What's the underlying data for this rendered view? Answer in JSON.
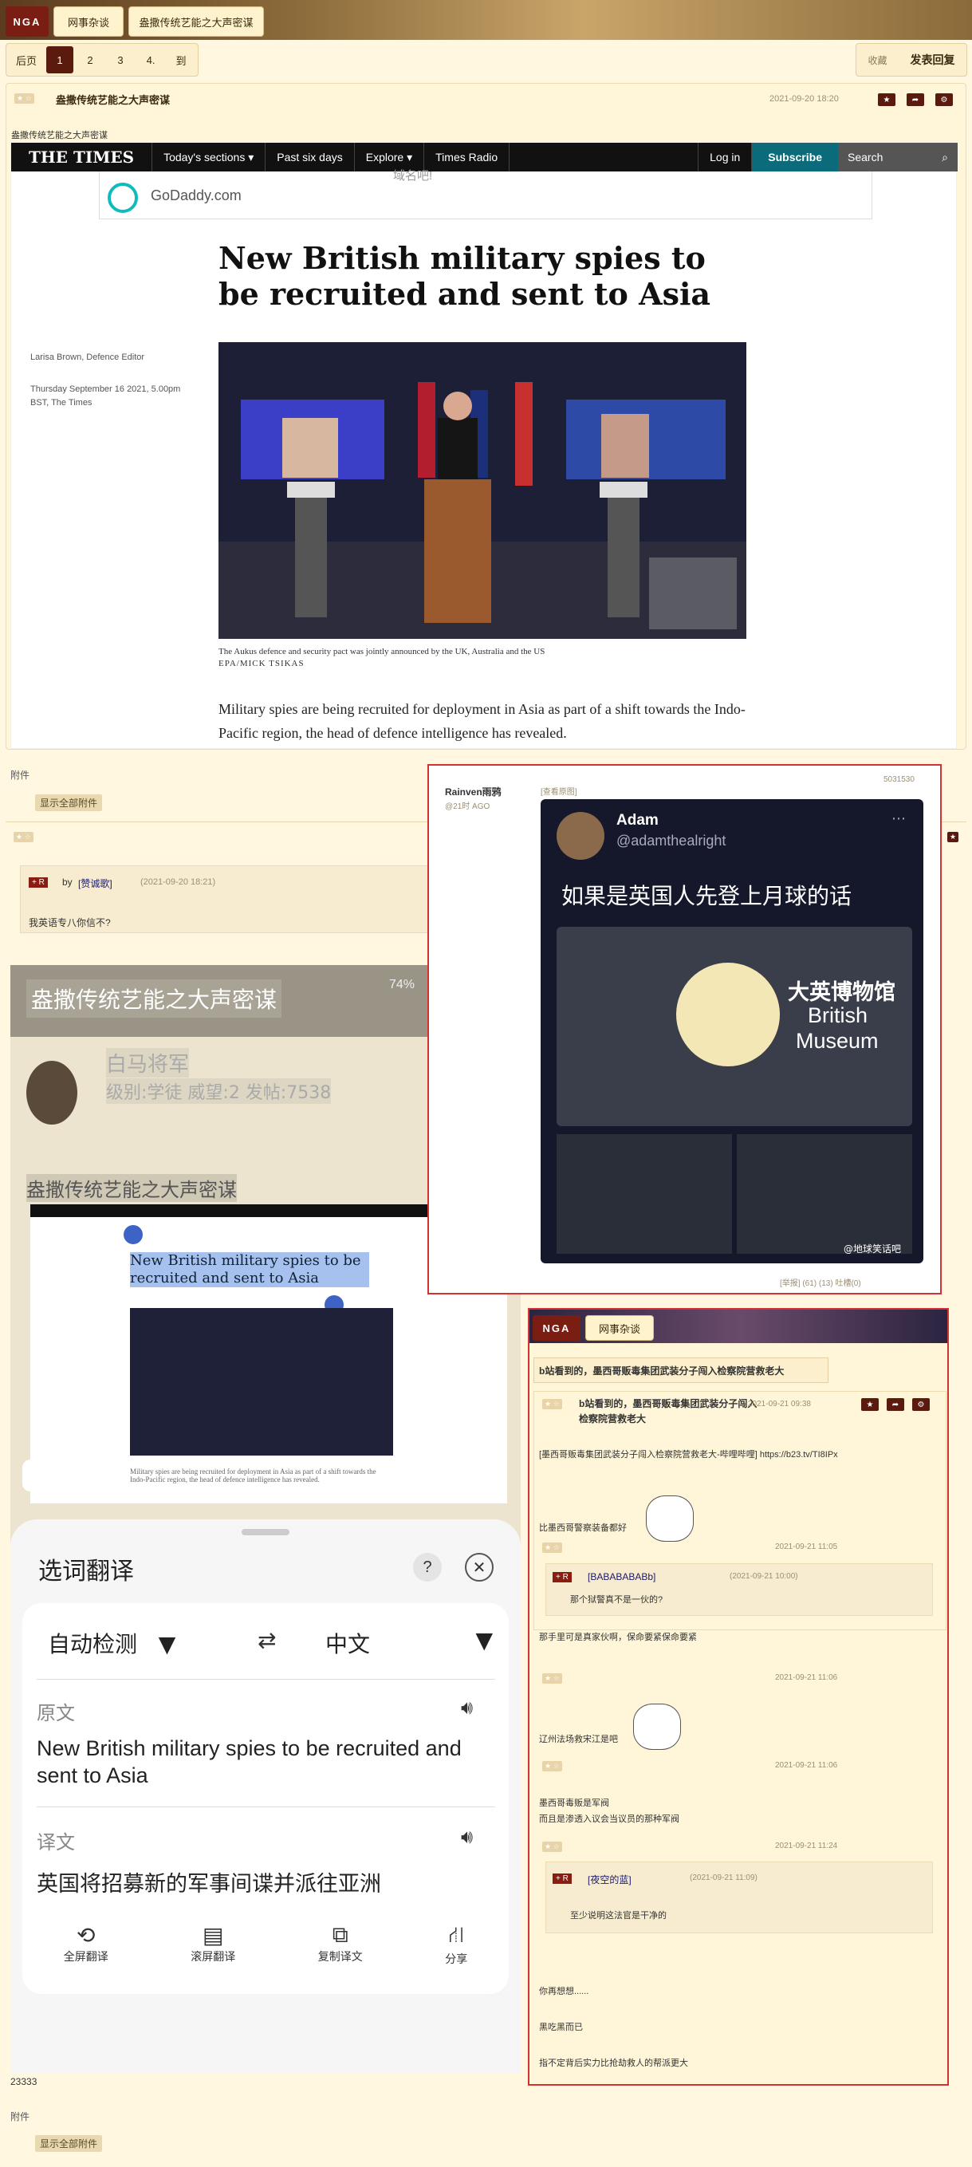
{
  "header": {
    "logo": "NGA",
    "forum_tab": "网事杂谈",
    "thread_tab": "盎撒传统艺能之大声密谋"
  },
  "pager": {
    "items": [
      "后页",
      "1",
      "2",
      "3",
      "4.",
      "到"
    ],
    "current": "1"
  },
  "actions": {
    "favorite": "收藏",
    "reply": "发表回复"
  },
  "main_post": {
    "title": "盎撒传统艺能之大声密谋",
    "timestamp": "2021-09-20 18:20",
    "subtitle": "盎撒传统艺能之大声密谋"
  },
  "times": {
    "brand": "THE TIMES",
    "nav": [
      "Today's sections",
      "Past six days",
      "Explore",
      "Times Radio"
    ],
    "login": "Log in",
    "subscribe": "Subscribe",
    "search": "Search",
    "ad_text": "GoDaddy.com",
    "ad_top": "域名吧!",
    "headline": "New British military spies to be recruited and sent to Asia",
    "author": "Larisa Brown, Defence Editor",
    "date": "Thursday September 16 2021, 5.00pm BST, The Times",
    "caption": "The Aukus defence and security pact was jointly announced by the UK, Australia and the US",
    "credit": "EPA/MICK TSIKAS",
    "lede": "Military spies are being recruited for deployment in Asia as part of a shift towards the Indo-Pacific region, the head of defence intelligence has revealed."
  },
  "attachments": {
    "label": "附件",
    "show_all": "显示全部附件"
  },
  "reply1": {
    "by": "by",
    "user": "[赞诚歌]",
    "time": "(2021-09-20 18:21)",
    "text": "我英语专八你信不?"
  },
  "screenshot": {
    "status": "74%",
    "title": "盎撒传统艺能之大声密谋",
    "user": "白马将军",
    "meta": "级别:学徒 威望:2 发帖:7538",
    "title2": "盎撒传统艺能之大声密谋",
    "highlight": "New British military spies to be recruited and sent to Asia",
    "lede_small": "Military spies are being recruited for deployment in Asia as part of a shift towards the Indo-Pacific region, the head of defence intelligence has revealed."
  },
  "translate": {
    "title": "选词翻译",
    "help": "?",
    "source_lang": "自动检测",
    "target_lang": "中文",
    "src_label": "原文",
    "src_text": "New British military spies to be recruited and sent to Asia",
    "dst_label": "译文",
    "dst_text": "英国将招募新的军事间谍并派往亚洲",
    "actions": [
      "全屏翻译",
      "滚屏翻译",
      "复制译文",
      "分享"
    ]
  },
  "popup1": {
    "user": "Rainven雨鸦",
    "time": "@21时 AGO",
    "view": "[查看原图]",
    "pid": "5031530",
    "tweet_name": "Adam",
    "tweet_handle": "@adamthealright",
    "tweet_text": "如果是英国人先登上月球的话",
    "museum": "大英博物馆",
    "museum_en1": "British",
    "museum_en2": "Museum",
    "watermark": "@地球笑话吧",
    "footer": "[举报]  (61)  (13) 吐槽(0)"
  },
  "popup2": {
    "logo": "NGA",
    "tab": "网事杂谈",
    "thread": "b站看到的，墨西哥贩毒集团武装分子闯入检察院营救老大",
    "post_title": "b站看到的，墨西哥贩毒集团武装分子闯入检察院营救老大",
    "post_time": "2021-09-21 09:38",
    "link_line": "[墨西哥贩毒集团武装分子闯入检察院营救老大-哔哩哔哩] https://b23.tv/TI8IPx",
    "body": "比墨西哥警察装备都好",
    "r1_time": "2021-09-21 11:05",
    "r1_user": "[BABABABABb]",
    "r1_qtime": "(2021-09-21 10:00)",
    "r1_quote": "那个狱警真不是一伙的?",
    "r1_text": "那手里可是真家伙啊，保命要紧保命要紧",
    "r2_time": "2021-09-21 11:06",
    "r2_text": "辽州法场救宋江是吧",
    "r3_time": "2021-09-21 11:06",
    "r3_line1": "墨西哥毒贩是军阀",
    "r3_line2": "而且是渗透入议会当议员的那种军阀",
    "r4_time": "2021-09-21 11:24",
    "r4_user": "[夜空的蓝]",
    "r4_qtime": "(2021-09-21 11:09)",
    "r4_quote": "至少说明这法官是干净的",
    "tail1": "你再想想......",
    "tail2": "黑吃黑而已",
    "tail3": "指不定背后实力比抢劫救人的帮派更大"
  },
  "footer": {
    "number": "23333",
    "attach": "附件",
    "show_all": "显示全部附件"
  }
}
